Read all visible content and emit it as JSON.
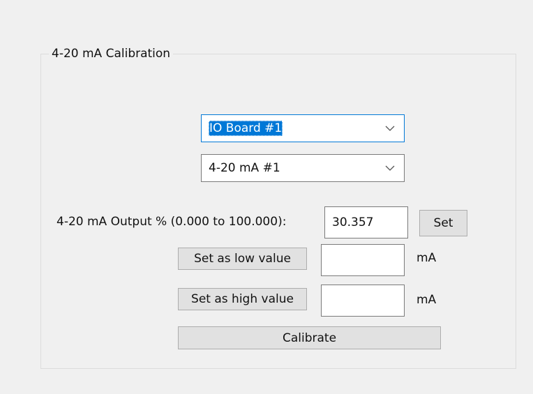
{
  "group": {
    "title": "4-20 mA Calibration"
  },
  "board_select": {
    "value": "IO Board #1"
  },
  "channel_select": {
    "value": "4-20 mA #1"
  },
  "output": {
    "label": "4-20 mA Output % (0.000 to 100.000):",
    "value": "30.357",
    "set_label": "Set"
  },
  "low": {
    "button_label": "Set as low value",
    "value": "",
    "unit": "mA"
  },
  "high": {
    "button_label": "Set as high value",
    "value": "",
    "unit": "mA"
  },
  "calibrate": {
    "label": "Calibrate"
  },
  "colors": {
    "background": "#f0f0f0",
    "focus_border": "#0078d7",
    "selection": "#0078d7",
    "button_face": "#e1e1e1",
    "button_border": "#adadad"
  },
  "icons": {
    "dropdown": "chevron-down-icon"
  }
}
